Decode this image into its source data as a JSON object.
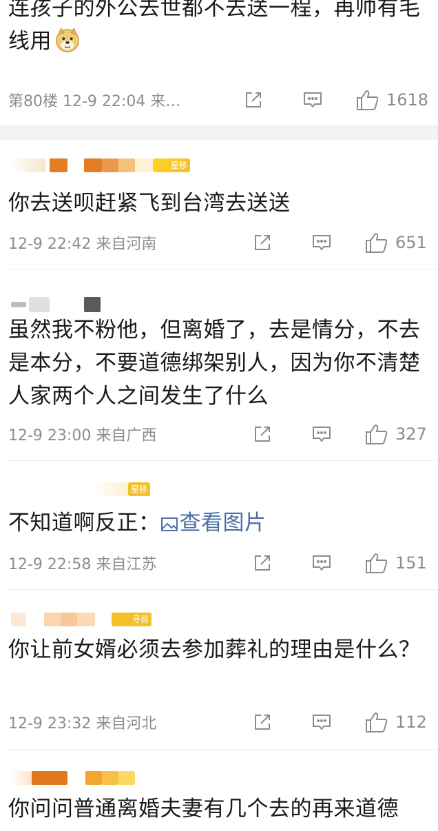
{
  "top_comment": {
    "text": "连孩子的外公去世都不去送一程，再帅有毛线用",
    "emoji": "doge-emoji",
    "floor_time": "第80楼 12-9 22:04 来…",
    "likes": "1618"
  },
  "comments": [
    {
      "text": "你去送呗赶紧飞到台湾去送送",
      "time": "12-9 22:42 来自河南",
      "likes": "651",
      "badge": "星移"
    },
    {
      "text": "虽然我不粉他，但离婚了，去是情分，不去是本分，不要道德绑架别人，因为你不清楚人家两个人之间发生了什么",
      "time": "12-9 23:00 来自广西",
      "likes": "327",
      "badge": ""
    },
    {
      "text": "不知道啊反正：",
      "link": "查看图片",
      "time": "12-9 22:58 来自江苏",
      "likes": "151",
      "badge": "星移"
    },
    {
      "text": "你让前女婿必须去参加葬礼的理由是什么？",
      "time": "12-9 23:32 来自河北",
      "likes": "112",
      "badge": "寻目"
    },
    {
      "text": "你问问普通离婚夫妻有几个去的再来道德",
      "badge": ""
    }
  ],
  "icons": {
    "share": "share-icon",
    "comment": "comment-icon",
    "like": "thumbs-up-icon",
    "image": "image-icon"
  },
  "colors": {
    "link": "#4b6fa8",
    "meta": "#8c8c8c",
    "badge": "#f5c128",
    "separator": "#f2f2f2"
  }
}
